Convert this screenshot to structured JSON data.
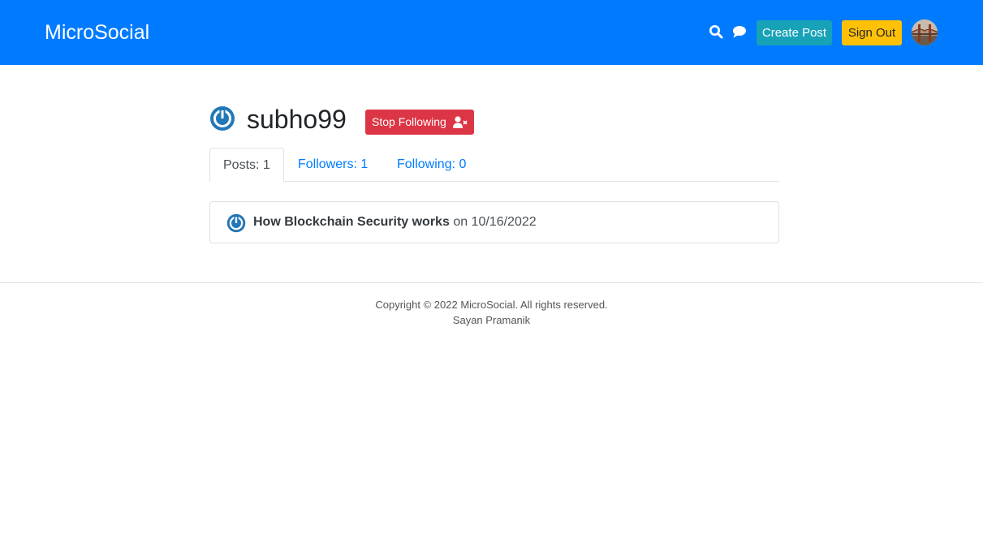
{
  "navbar": {
    "brand": "MicroSocial",
    "search_icon": "search-icon",
    "chat_icon": "comment-icon",
    "create_post_label": "Create Post",
    "sign_out_label": "Sign Out",
    "color": "#007bff"
  },
  "profile": {
    "username": "subho99",
    "unfollow_label": "Stop Following",
    "unfollow_icon": "user-times-icon"
  },
  "tabs": [
    {
      "label": "Posts: 1",
      "active": true
    },
    {
      "label": "Followers: 1",
      "active": false
    },
    {
      "label": "Following: 0",
      "active": false
    }
  ],
  "posts": [
    {
      "title": "How Blockchain Security works",
      "date_text": "on 10/16/2022"
    }
  ],
  "footer": {
    "copyright": "Copyright © 2022 MicroSocial. All rights reserved.",
    "author": "Sayan Pramanik"
  }
}
